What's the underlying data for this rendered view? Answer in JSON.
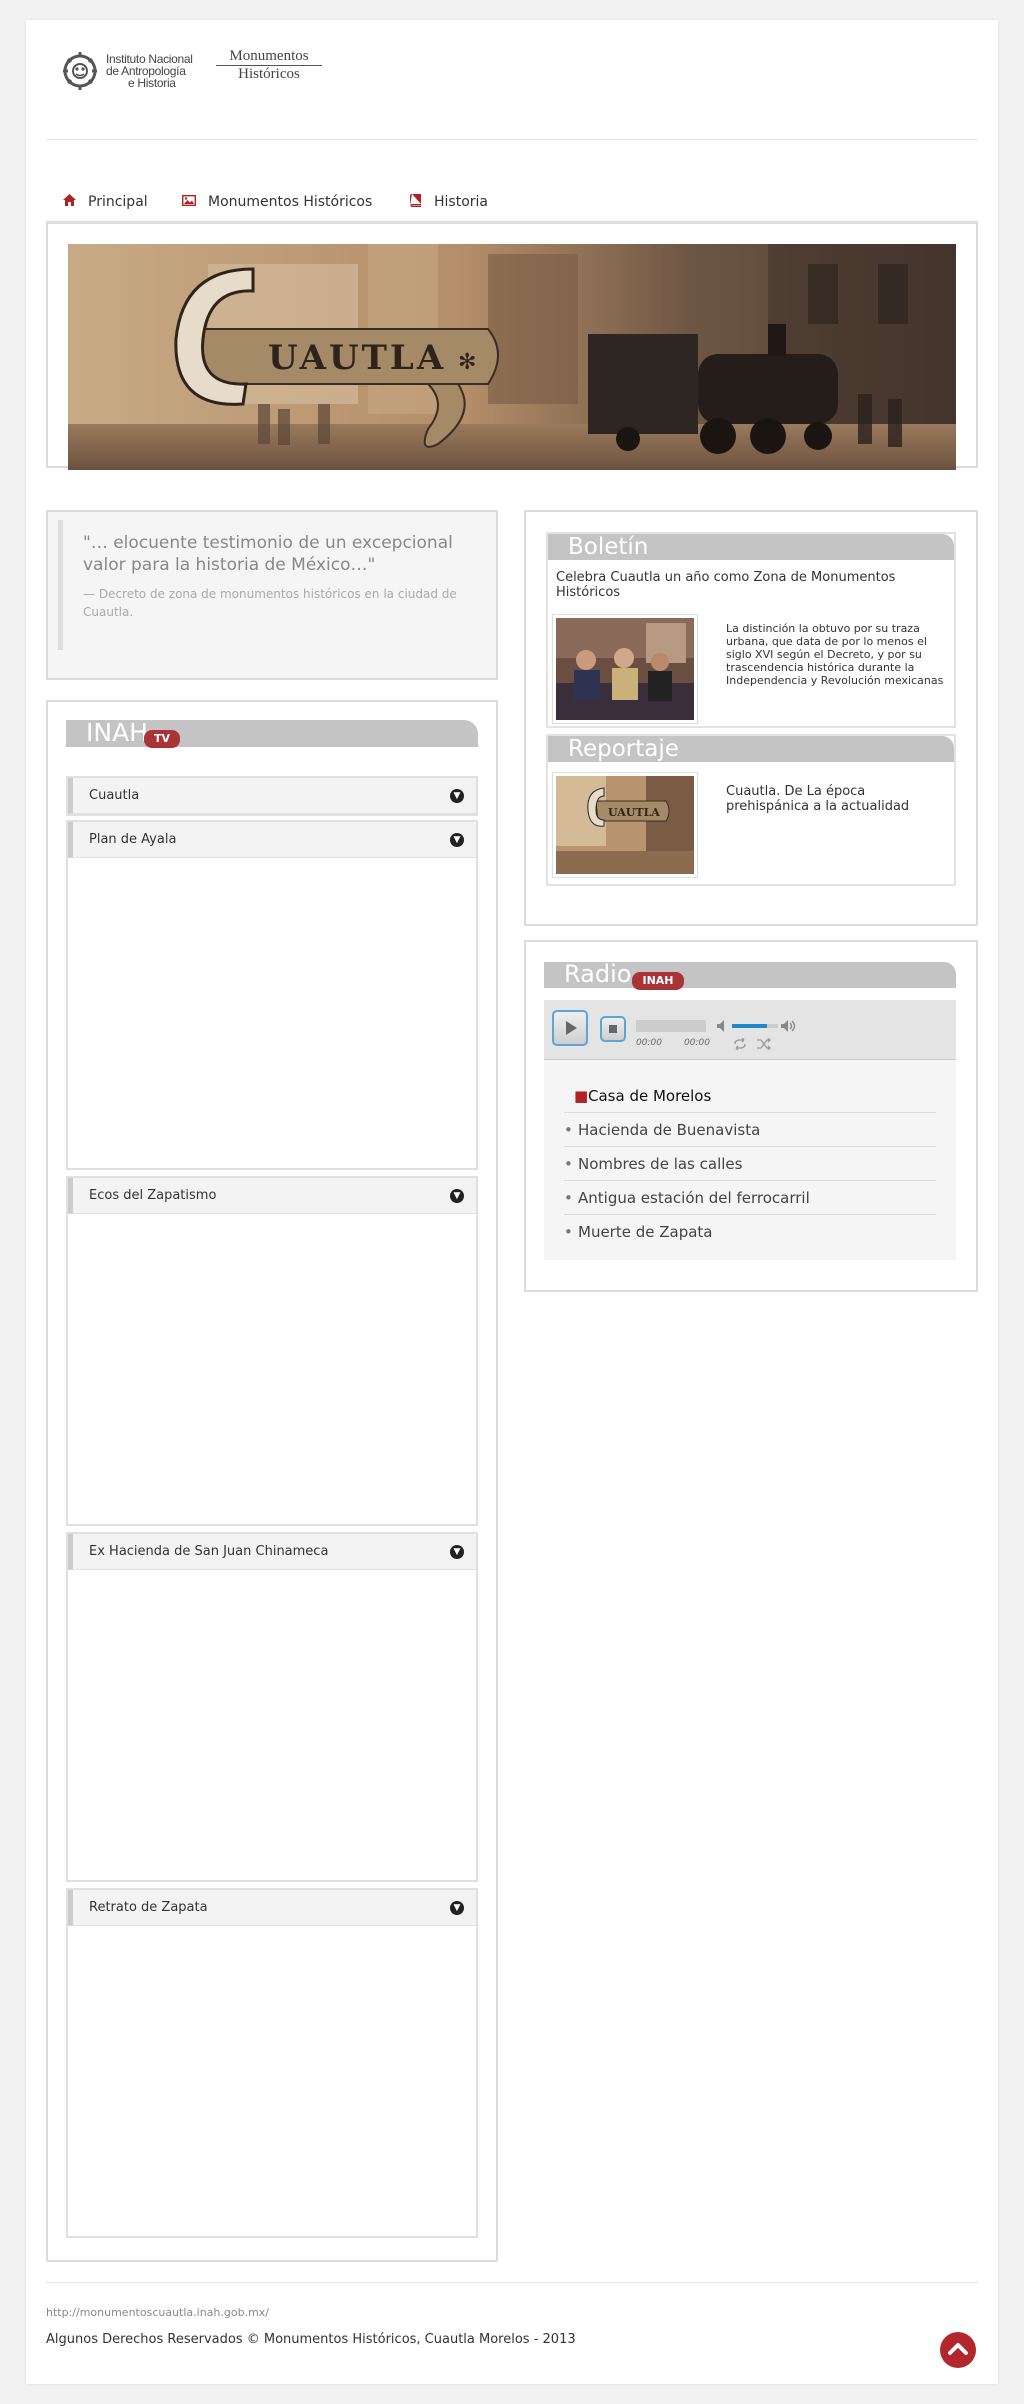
{
  "logos": {
    "inah_text": [
      "Instituto Nacional",
      "de Antropología",
      "e Historia"
    ],
    "mh_line1": "Monumentos",
    "mh_line2": "Históricos"
  },
  "nav": {
    "items": [
      {
        "label": "Principal",
        "icon": "home-icon"
      },
      {
        "label": "Monumentos Históricos",
        "icon": "image-icon"
      },
      {
        "label": "Historia",
        "icon": "book-icon"
      }
    ]
  },
  "banner": {
    "text": "CUAUTLA"
  },
  "quote": {
    "text": "\"… elocuente testimonio de un excepcional valor para la historia de México…\"",
    "source": "— Decreto de zona de monumentos históricos en la ciudad de Cuautla."
  },
  "tv": {
    "title": "INAH",
    "badge": "TV",
    "items": [
      "Cuautla",
      "Plan de Ayala",
      "Ecos del Zapatismo",
      "Ex Hacienda de San Juan Chinameca",
      "Retrato de Zapata"
    ]
  },
  "boletin": {
    "title": "Boletín",
    "headline": "Celebra Cuautla un año como Zona de Monumentos Históricos",
    "text": "La distinción la obtuvo por su traza urbana, que data de por lo menos el siglo XVI según el Decreto, y por su trascendencia histórica durante la Independencia y Revolución mexicanas"
  },
  "reportaje": {
    "title": "Reportaje",
    "text": "Cuautla. De La época prehispánica a la actualidad"
  },
  "radio": {
    "title": "Radio",
    "badge": "INAH",
    "time_current": "00:00",
    "time_total": "00:00",
    "volume": 0.75,
    "playlist": [
      "Casa de Morelos",
      "Hacienda de Buenavista",
      "Nombres de las calles",
      "Antigua estación del ferrocarril",
      "Muerte de Zapata"
    ]
  },
  "footer": {
    "url": "http://monumentoscuautla.inah.gob.mx/",
    "copyright": "Algunos Derechos Reservados © Monumentos Históricos, Cuautla Morelos - 2013"
  },
  "colors": {
    "accent": "#b3262c",
    "title_bar": "#c4c4c4",
    "player_blue": "#1e88c8"
  }
}
